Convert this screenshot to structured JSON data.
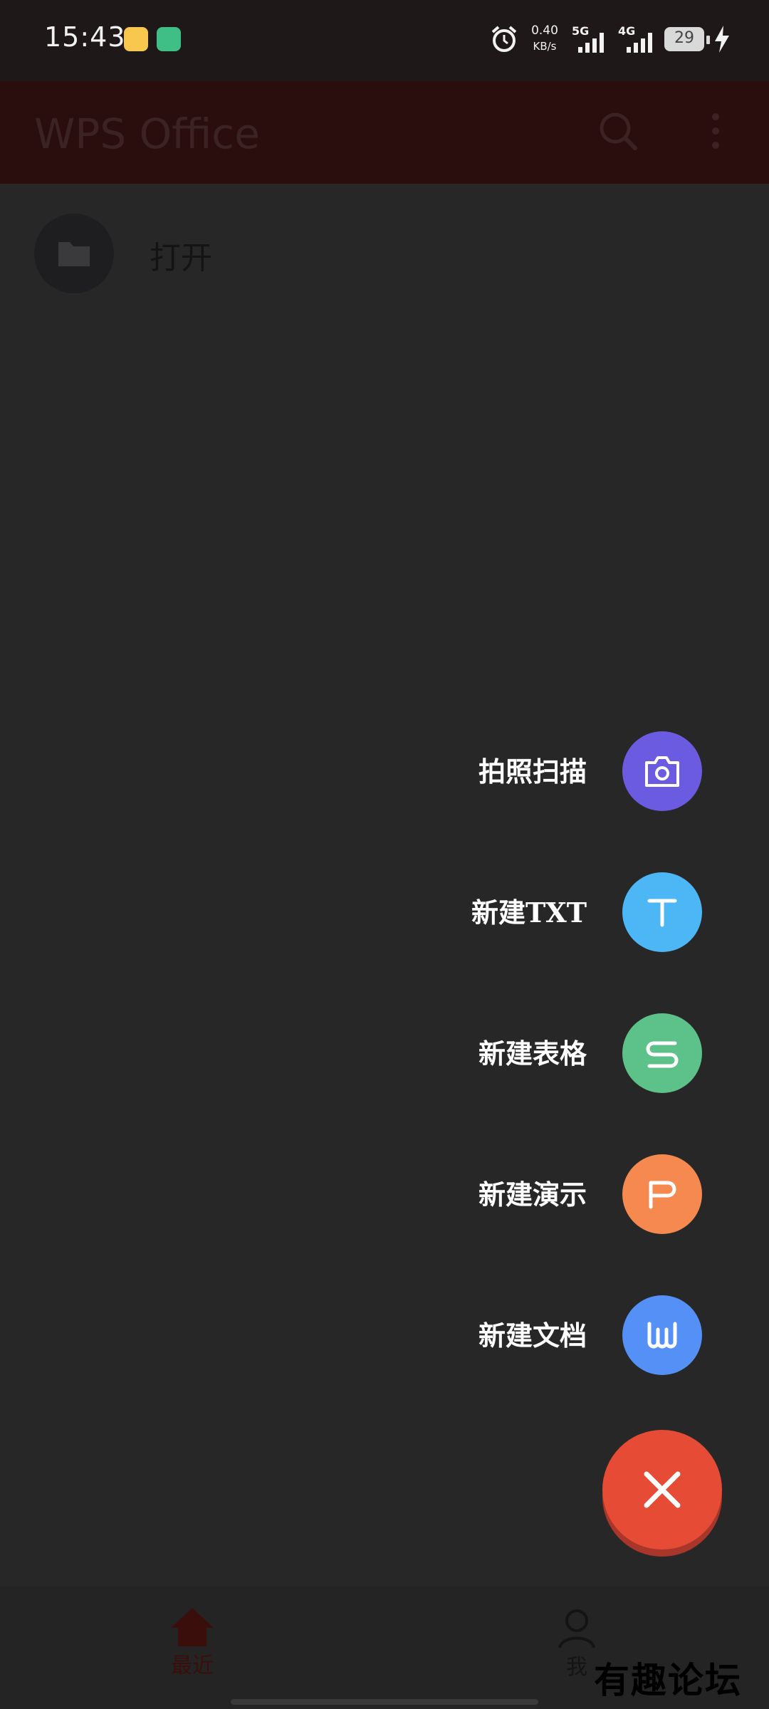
{
  "status_bar": {
    "time": "15:43",
    "net_speed_value": "0.40",
    "net_speed_unit": "KB/s",
    "net1": "5G",
    "net2": "4G",
    "battery": "29"
  },
  "app_bar": {
    "title": "WPS Office",
    "search_icon": "search-icon",
    "more_icon": "more-vert-icon"
  },
  "open_row": {
    "label": "打开",
    "icon": "folder-icon"
  },
  "fab_menu": {
    "items": [
      {
        "label": "拍照扫描",
        "icon": "camera-icon",
        "color": "#6a5be0"
      },
      {
        "label": "新建TXT",
        "icon": "txt-icon",
        "color": "#4db6f5"
      },
      {
        "label": "新建表格",
        "icon": "spreadsheet-icon",
        "color": "#5cc28a"
      },
      {
        "label": "新建演示",
        "icon": "presentation-icon",
        "color": "#f5894f"
      },
      {
        "label": "新建文档",
        "icon": "document-icon",
        "color": "#5490f5"
      }
    ],
    "close_icon": "close-icon",
    "close_color": "#e64b35"
  },
  "bottom_nav": {
    "recent_label": "最近",
    "me_label": "我"
  },
  "watermark": "有趣论坛"
}
